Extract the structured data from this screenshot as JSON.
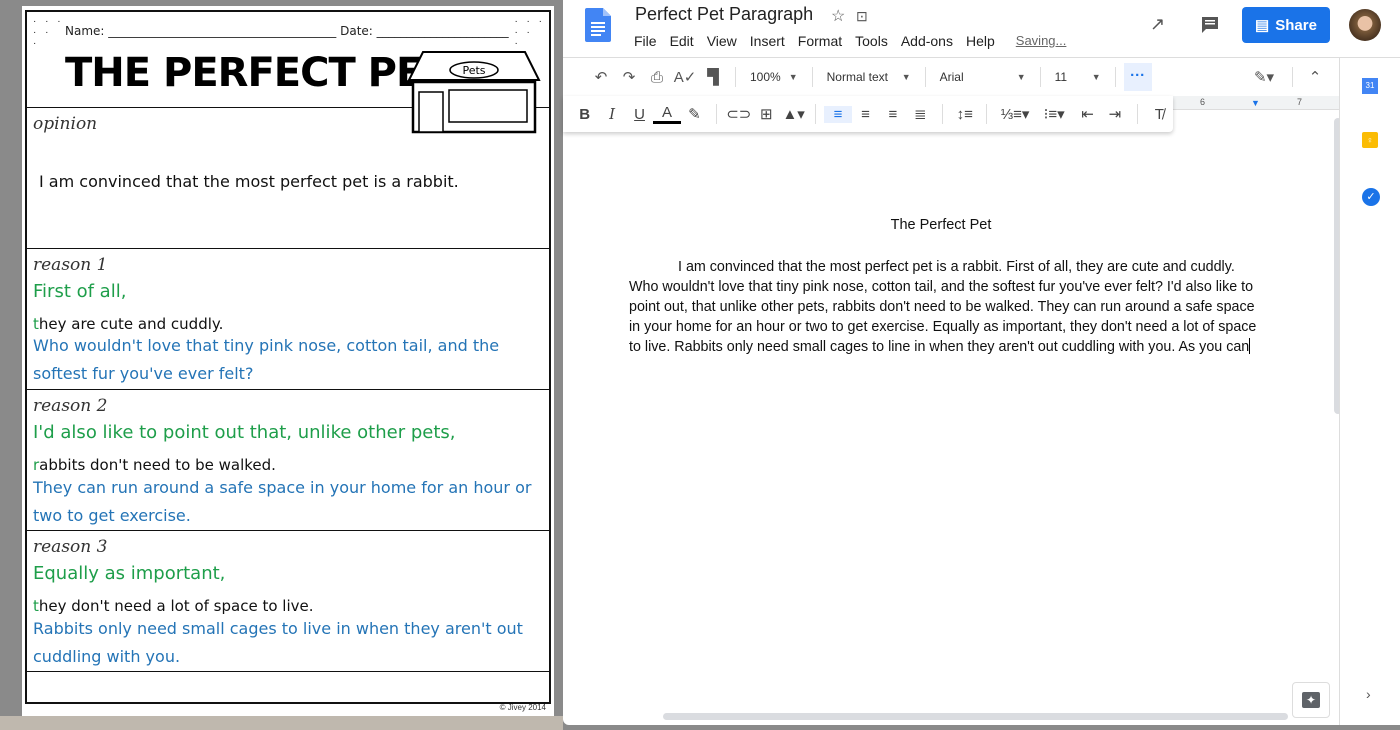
{
  "worksheet": {
    "name_label": "Name: ______________________________________",
    "date_label": "Date: ______________________",
    "title": "THE PERFECT PET",
    "shop_sign": "Pets",
    "opinion": {
      "label": "opinion",
      "text": "I am convinced that the most perfect pet is a rabbit."
    },
    "reasons": [
      {
        "label": "reason 1",
        "transition": "First of all,",
        "first_letter": "t",
        "reason": "hey are cute and cuddly.",
        "detail1": "Who wouldn't love that tiny pink nose, cotton tail, and the",
        "detail2": "softest fur you've ever felt?"
      },
      {
        "label": "reason 2",
        "transition": "I'd also like to point out that, unlike other pets,",
        "first_letter": "r",
        "reason": "abbits don't need to be walked.",
        "detail1": "They can run around a safe space in your home for an hour or",
        "detail2": "two to get exercise."
      },
      {
        "label": "reason 3",
        "transition": "Equally as important,",
        "first_letter": "t",
        "reason": "hey don't need a lot of space to live.",
        "detail1": "Rabbits only need small cages to live in when they aren't out",
        "detail2": "cuddling with you."
      }
    ],
    "copyright": "© Jivey 2014"
  },
  "docs": {
    "title": "Perfect Pet Paragraph",
    "menu": [
      "File",
      "Edit",
      "View",
      "Insert",
      "Format",
      "Tools",
      "Add-ons",
      "Help"
    ],
    "status": "Saving...",
    "share_label": "Share",
    "toolbar": {
      "zoom": "100%",
      "style": "Normal text",
      "font": "Arial",
      "size": "11"
    },
    "ruler": {
      "mark6": "6",
      "mark7": "7"
    },
    "doc_title": "The Perfect Pet",
    "paragraph": "I am convinced that the most perfect pet is a rabbit. First of all, they are cute and cuddly. Who wouldn't love that tiny pink nose, cotton tail, and the softest fur you've ever felt? I'd also like to point out, that unlike other pets, rabbits don't need to be walked. They can run around a safe space in your home for an hour or two to get exercise. Equally as important, they don't need a lot of space to live. Rabbits only need small cages to line in when they aren't out cuddling with you. As you can",
    "colors": {
      "accent": "#1a73e8",
      "green": "#1e9e4a",
      "blue": "#2474b6"
    }
  }
}
